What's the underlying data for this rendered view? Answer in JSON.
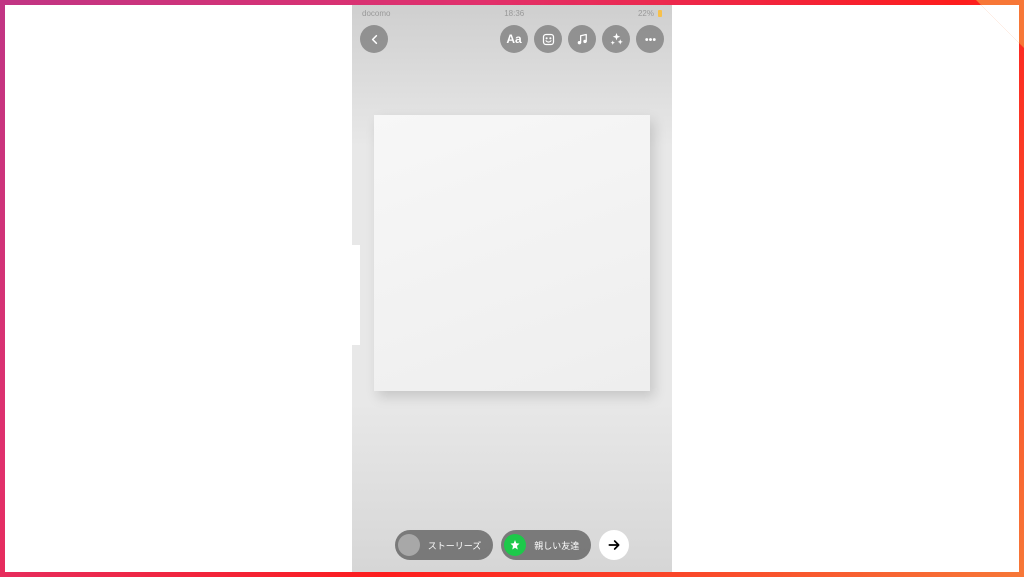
{
  "statusBar": {
    "carrier": "docomo",
    "time": "18:36",
    "battery": "22%"
  },
  "toolbar": {
    "textToolLabel": "Aa"
  },
  "bottomBar": {
    "storiesLabel": "ストーリーズ",
    "closeFriendsLabel": "親しい友達"
  }
}
